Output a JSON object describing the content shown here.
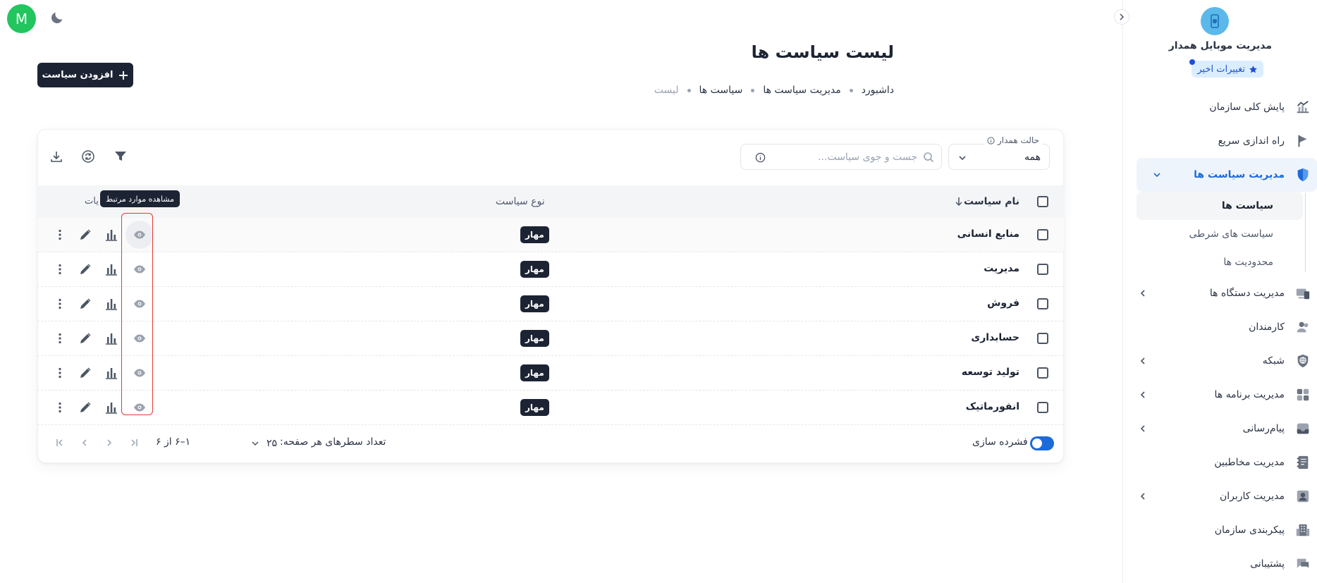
{
  "topbar": {
    "avatar_letter": "M",
    "theme_icon": "moon-icon"
  },
  "sidebar": {
    "brand_title": "مدیریت موبایل همدار",
    "recent_changes": "تغییرات اخیر",
    "items": [
      {
        "label": "پایش کلی سازمان",
        "icon": "chart-trend-icon"
      },
      {
        "label": "راه اندازی سریع",
        "icon": "flag-icon"
      },
      {
        "label": "مدیریت سیاست ها",
        "icon": "shield-icon",
        "active": true
      },
      {
        "label": "مدیریت دستگاه ها",
        "icon": "devices-icon"
      },
      {
        "label": "کارمندان",
        "icon": "people-icon"
      },
      {
        "label": "شبکه",
        "icon": "globe-icon"
      },
      {
        "label": "مدیریت برنامه ها",
        "icon": "apps-icon"
      },
      {
        "label": "پیام‌رسانی",
        "icon": "inbox-icon"
      },
      {
        "label": "مدیریت مخاطبین",
        "icon": "contacts-icon"
      },
      {
        "label": "مدیریت کاربران",
        "icon": "user-icon"
      },
      {
        "label": "پیکربندی سازمان",
        "icon": "building-icon"
      },
      {
        "label": "پشتیبانی",
        "icon": "chat-icon"
      }
    ],
    "subitems": [
      {
        "label": "سیاست ها",
        "current": true
      },
      {
        "label": "سیاست های شرطی"
      },
      {
        "label": "محدودیت ها"
      }
    ]
  },
  "header": {
    "title": "لیست سیاست ها",
    "breadcrumb": [
      "داشبورد",
      "مدیریت سیاست ها",
      "سیاست ها",
      "لیست"
    ],
    "add_button": "افزودن سیاست"
  },
  "filters": {
    "state_label": "حالت همدار",
    "state_value": "همه",
    "search_placeholder": "جست و جوی سیاست..."
  },
  "table": {
    "columns": {
      "name": "نام سیاست",
      "type": "نوع سیاست",
      "actions_tail": "یات"
    },
    "tooltip": "مشاهده موارد مرتبط",
    "rows": [
      {
        "name": "منابع انسانی",
        "type": "مهار"
      },
      {
        "name": "مدیریت",
        "type": "مهار"
      },
      {
        "name": "فروش",
        "type": "مهار"
      },
      {
        "name": "حسابداری",
        "type": "مهار"
      },
      {
        "name": "تولید توسعه",
        "type": "مهار"
      },
      {
        "name": "انفورماتیک",
        "type": "مهار"
      }
    ]
  },
  "footer": {
    "dense_label": "فشرده سازی",
    "dense_on": true,
    "rows_per_page_label": "تعداد سطرهای هر صفحه:",
    "rows_per_page": "۲۵",
    "range": "۱–۶ از ۶"
  },
  "colors": {
    "primary": "#1c2434",
    "accent": "#1c6bd8",
    "success": "#22c55e",
    "highlight": "#e53935"
  }
}
